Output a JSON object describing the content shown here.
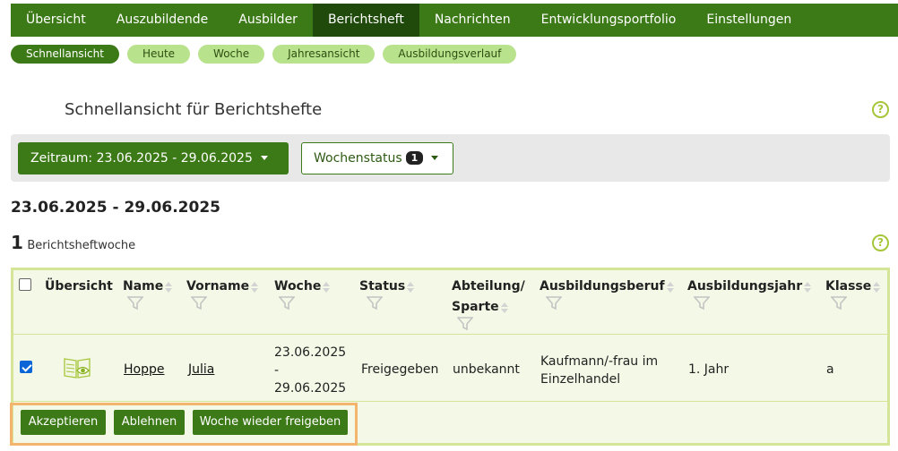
{
  "nav": {
    "items": [
      "Übersicht",
      "Auszubildende",
      "Ausbilder",
      "Berichtsheft",
      "Nachrichten",
      "Entwicklungsportfolio",
      "Einstellungen"
    ],
    "active_index": 3
  },
  "subnav": {
    "items": [
      "Schnellansicht",
      "Heute",
      "Woche",
      "Jahresansicht",
      "Ausbildungsverlauf"
    ],
    "active_index": 0
  },
  "page": {
    "title": "Schnellansicht für Berichtshefte",
    "help_symbol": "?"
  },
  "filters": {
    "zeitraum_label": "Zeitraum: 23.06.2025 - 29.06.2025",
    "wochenstatus_label": "Wochenstatus",
    "wochenstatus_count": "1"
  },
  "summary": {
    "date_range": "23.06.2025 - 29.06.2025",
    "count": "1",
    "count_label": "Berichtsheftwoche"
  },
  "table": {
    "headers": {
      "uebersicht": "Übersicht",
      "name": "Name",
      "vorname": "Vorname",
      "woche": "Woche",
      "status": "Status",
      "abteilung_1": "Abteilung/",
      "abteilung_2": "Sparte",
      "ausbildungsberuf": "Ausbildungsberuf",
      "ausbildungsjahr": "Ausbildungsjahr",
      "klasse": "Klasse"
    },
    "rows": [
      {
        "checked": true,
        "name": "Hoppe",
        "vorname": "Julia",
        "woche_1": "23.06.2025",
        "woche_2": "-",
        "woche_3": "29.06.2025",
        "status": "Freigegeben",
        "abteilung": "unbekannt",
        "beruf_1": "Kaufmann/-frau im",
        "beruf_2": "Einzelhandel",
        "jahr": "1. Jahr",
        "klasse": "a"
      }
    ]
  },
  "actions": {
    "accept": "Akzeptieren",
    "reject": "Ablehnen",
    "release": "Woche wieder freigeben"
  },
  "colors": {
    "nav_green": "#3c7a17",
    "nav_active": "#1f4a0b",
    "pill_light": "#b9e28c",
    "table_border": "#d5e597",
    "action_outline": "#f3b46e",
    "help_icon": "#a6c63a"
  }
}
